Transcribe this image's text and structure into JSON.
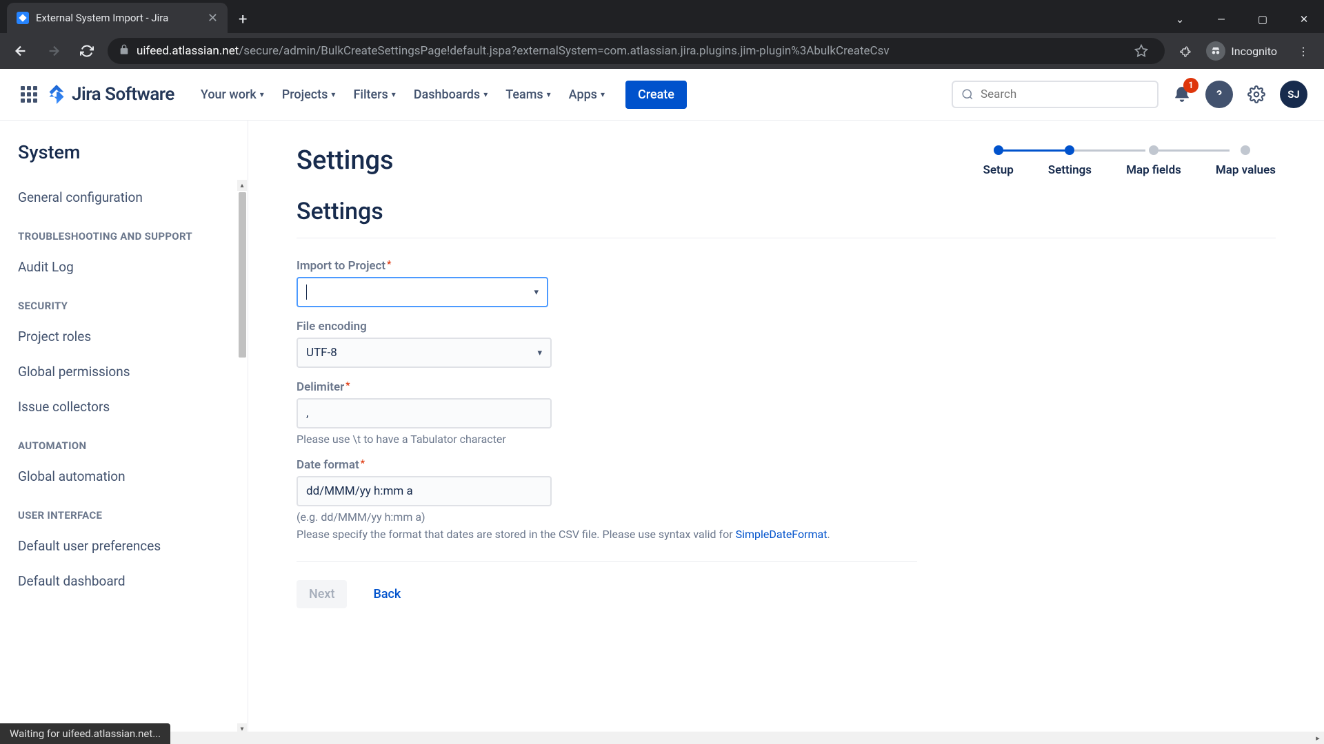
{
  "browser": {
    "tab_title": "External System Import - Jira",
    "url_host": "uifeed.atlassian.net",
    "url_path": "/secure/admin/BulkCreateSettingsPage!default.jspa?externalSystem=com.atlassian.jira.plugins.jim-plugin%3AbulkCreateCsv",
    "incognito_label": "Incognito",
    "status_text": "Waiting for uifeed.atlassian.net..."
  },
  "header": {
    "logo_text": "Jira Software",
    "nav": [
      "Your work",
      "Projects",
      "Filters",
      "Dashboards",
      "Teams",
      "Apps"
    ],
    "create_label": "Create",
    "search_placeholder": "Search",
    "notif_count": "1",
    "avatar_initials": "SJ"
  },
  "sidebar": {
    "title": "System",
    "items": [
      {
        "type": "link",
        "label": "General configuration"
      },
      {
        "type": "section",
        "label": "TROUBLESHOOTING AND SUPPORT"
      },
      {
        "type": "link",
        "label": "Audit Log"
      },
      {
        "type": "section",
        "label": "SECURITY"
      },
      {
        "type": "link",
        "label": "Project roles"
      },
      {
        "type": "link",
        "label": "Global permissions"
      },
      {
        "type": "link",
        "label": "Issue collectors"
      },
      {
        "type": "section",
        "label": "AUTOMATION"
      },
      {
        "type": "link",
        "label": "Global automation"
      },
      {
        "type": "section",
        "label": "USER INTERFACE"
      },
      {
        "type": "link",
        "label": "Default user preferences"
      },
      {
        "type": "link",
        "label": "Default dashboard"
      }
    ]
  },
  "main": {
    "page_title": "Settings",
    "steps": [
      {
        "label": "Setup",
        "state": "done"
      },
      {
        "label": "Settings",
        "state": "active"
      },
      {
        "label": "Map fields",
        "state": "todo"
      },
      {
        "label": "Map values",
        "state": "todo"
      }
    ],
    "section_title": "Settings",
    "fields": {
      "import_project": {
        "label": "Import to Project",
        "required": true,
        "value": ""
      },
      "file_encoding": {
        "label": "File encoding",
        "required": false,
        "value": "UTF-8"
      },
      "delimiter": {
        "label": "Delimiter",
        "required": true,
        "value": ",",
        "help": "Please use \\t to have a Tabulator character"
      },
      "date_format": {
        "label": "Date format",
        "required": true,
        "value": "dd/MMM/yy h:mm a",
        "example": "(e.g. dd/MMM/yy h:mm a)",
        "help_pre": "Please specify the format that dates are stored in the CSV file. Please use syntax valid for ",
        "help_link": "SimpleDateFormat",
        "help_post": "."
      }
    },
    "buttons": {
      "next": "Next",
      "back": "Back"
    }
  }
}
